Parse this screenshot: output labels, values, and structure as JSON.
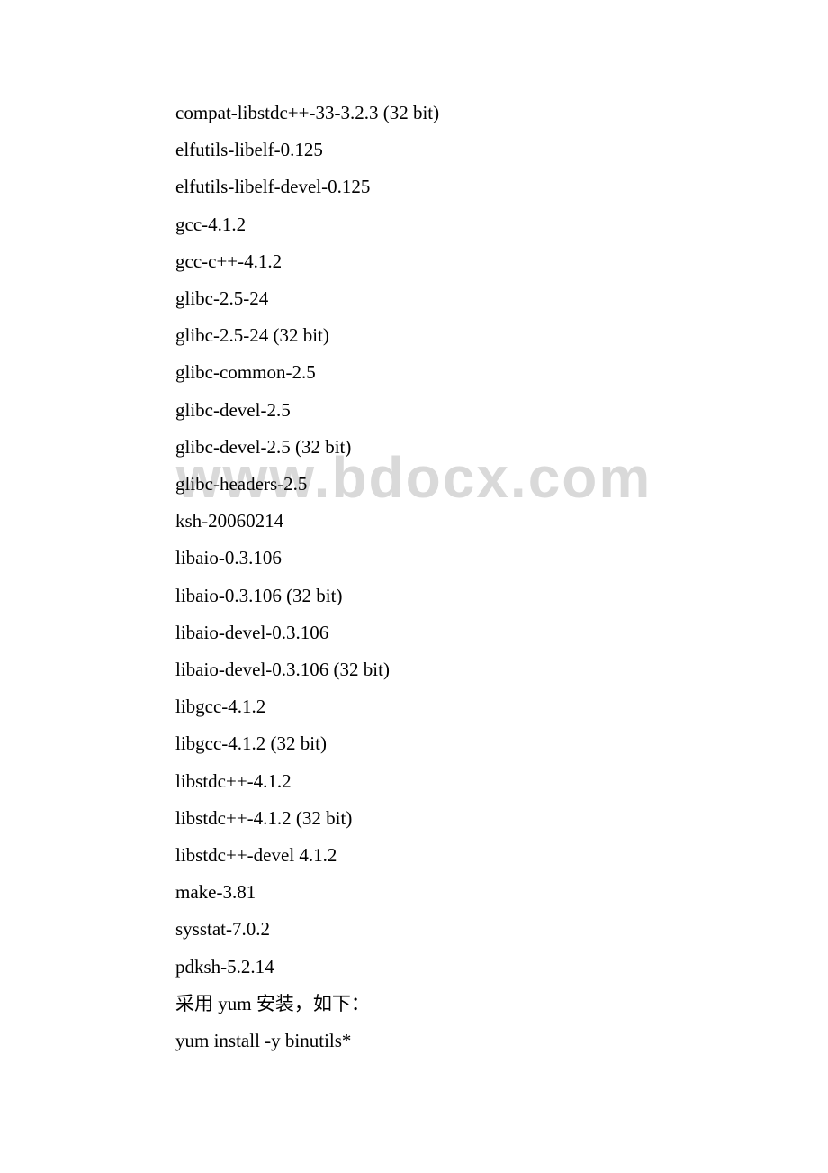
{
  "watermark": "www.bdocx.com",
  "lines": [
    "compat-libstdc++-33-3.2.3 (32 bit)",
    "elfutils-libelf-0.125",
    "elfutils-libelf-devel-0.125",
    "gcc-4.1.2",
    "gcc-c++-4.1.2",
    "glibc-2.5-24",
    "glibc-2.5-24 (32 bit)",
    "glibc-common-2.5",
    "glibc-devel-2.5",
    "glibc-devel-2.5 (32 bit)",
    "glibc-headers-2.5",
    "ksh-20060214",
    "libaio-0.3.106",
    "libaio-0.3.106 (32 bit)",
    "libaio-devel-0.3.106",
    "libaio-devel-0.3.106 (32 bit)",
    "libgcc-4.1.2",
    "libgcc-4.1.2 (32 bit)",
    "libstdc++-4.1.2",
    "libstdc++-4.1.2 (32 bit)",
    "libstdc++-devel 4.1.2",
    "make-3.81",
    "sysstat-7.0.2",
    "pdksh-5.2.14",
    "采用 yum 安装，如下：",
    "yum install -y binutils*"
  ]
}
